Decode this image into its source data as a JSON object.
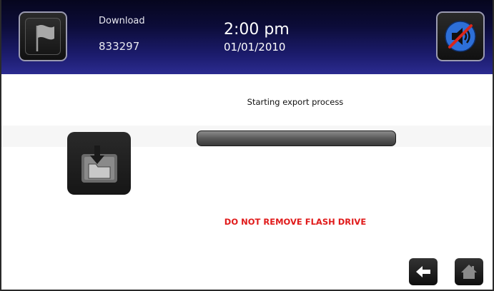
{
  "header": {
    "title": "Download",
    "code": "833297",
    "time": "2:00 pm",
    "date": "01/01/2010",
    "flag_icon": "flag-icon",
    "mute_icon": "speaker-muted-icon"
  },
  "main": {
    "status_text": "Starting export process",
    "progress_percent": 0,
    "export_icon": "folder-download-icon",
    "warning_text": "DO NOT REMOVE FLASH DRIVE"
  },
  "footer": {
    "back_icon": "arrow-left-icon",
    "home_icon": "home-icon"
  },
  "colors": {
    "header_dark": "#06061e",
    "header_light": "#2b2b90",
    "warning": "#e01a1a",
    "progress_track": "#555555",
    "mute_circle": "#2d6fd8",
    "mute_slash": "#d8261a"
  }
}
